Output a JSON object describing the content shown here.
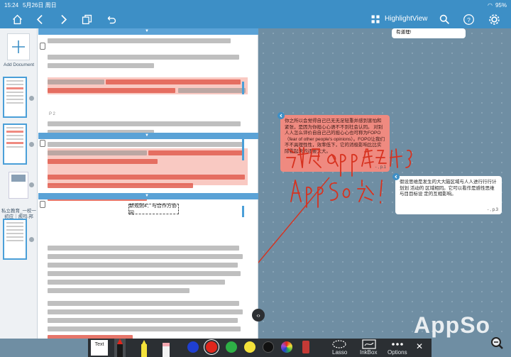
{
  "status": {
    "time": "15:24",
    "date": "5月26日 周日",
    "battery": "95%"
  },
  "toolbar": {
    "title": "HighlightView",
    "icons": [
      "home-icon",
      "back-icon",
      "forward-icon",
      "copy-icon",
      "undo-icon",
      "search-icon",
      "help-icon",
      "settings-icon"
    ]
  },
  "sidebar": {
    "add_label": "Add Document",
    "doc_label": "私立教育_一校一初应｜疾吗.邦"
  },
  "doc": {
    "page_label": "P 2",
    "box_text": "新规则4：与合作方协同"
  },
  "canvas": {
    "card1": {
      "text": "有道理!",
      "page": ""
    },
    "card2": {
      "text": "你之所以会觉得自己已无无足轻重并感到害怕和紧张，是因为你担心心语不不到社会认同。 对别人人怎么评价自自己己的担心心也可称为FOPO（fear of other people's opinions）。FOPO让我们不不具理性性，效率低下，它的消极影响比比实际看起来的还要大大。",
      "page": "- , p.1"
    },
    "card3": {
      "text": "假设思维是发生的大大脑区域与人人进行行行计划划 活动的 区域相同。它可以看作是感性思维与目目标设 定的互相影响。",
      "page": "- , p.3"
    },
    "handwriting": "这个app真好用 AppSo说！"
  },
  "bottom": {
    "text_tool": "Text",
    "lasso": "Lasso",
    "inkbox": "InkBox",
    "options": "Options",
    "colors": [
      "#1f3fd1",
      "#e0261c",
      "#2eb046",
      "#f4e23a",
      "#111111",
      "#9d4ed6",
      "#c43a36"
    ]
  },
  "watermark": "AppSo"
}
